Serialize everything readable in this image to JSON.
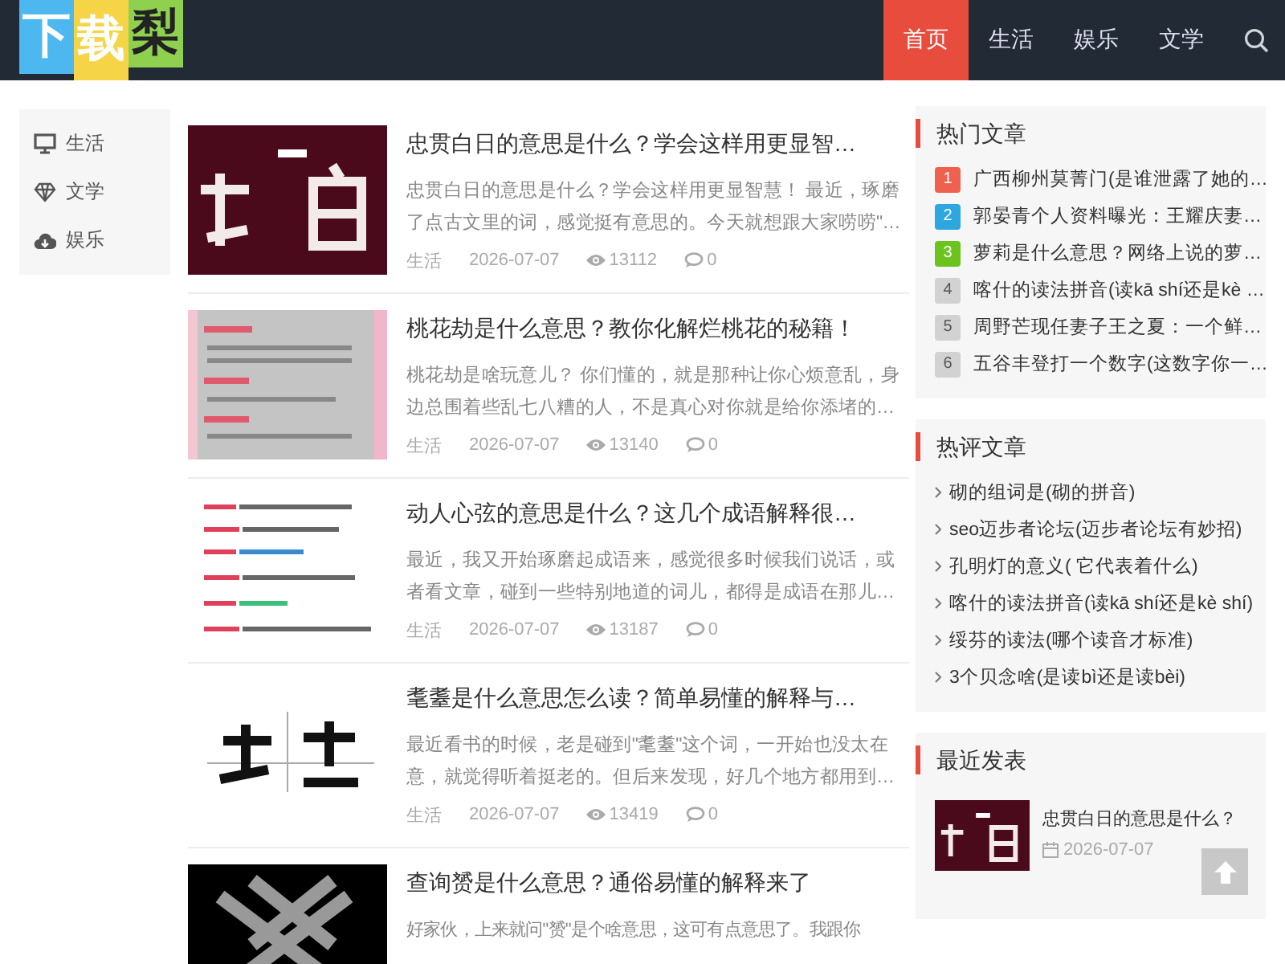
{
  "logo": {
    "tiles": [
      {
        "text": "下",
        "color": "#4cb8ef"
      },
      {
        "text": "载",
        "color": "#f5d547"
      },
      {
        "text": "梨",
        "color": "#8fd14f"
      }
    ]
  },
  "nav": [
    {
      "label": "首页",
      "selected": true
    },
    {
      "label": "生活",
      "selected": false
    },
    {
      "label": "娱乐",
      "selected": false
    },
    {
      "label": "文学",
      "selected": false
    }
  ],
  "sidebar": {
    "items": [
      {
        "label": "生活",
        "kind": "monitor"
      },
      {
        "label": "文学",
        "kind": "diamond"
      },
      {
        "label": "娱乐",
        "kind": "cloud"
      }
    ]
  },
  "articles": [
    {
      "title": "忠贯白日的意思是什么？学会这样用更显智…",
      "excerpt": "忠贯白日的意思是什么？学会这样用更显智慧！ 最近，琢磨了点古文里的词，感觉挺有意思的。今天就想跟大家唠唠\"…",
      "category": "生活",
      "date": "2026-07-07",
      "views": "13112",
      "comments": "0"
    },
    {
      "title": "桃花劫是什么意思？教你化解烂桃花的秘籍！",
      "excerpt": "桃花劫是啥玩意儿？ 你们懂的，就是那种让你心烦意乱，身边总围着些乱七八糟的人，不是真心对你就是给你添堵的…",
      "category": "生活",
      "date": "2026-07-07",
      "views": "13140",
      "comments": "0"
    },
    {
      "title": "动人心弦的意思是什么？这几个成语解释很…",
      "excerpt": "最近，我又开始琢磨起成语来，感觉很多时候我们说话，或者看文章，碰到一些特别地道的词儿，都得是成语在那儿…",
      "category": "生活",
      "date": "2026-07-07",
      "views": "13187",
      "comments": "0"
    },
    {
      "title": "耄耋是什么意思怎么读？简单易懂的解释与…",
      "excerpt": "最近看书的时候，老是碰到\"耄耋\"这个词，一开始也没太在意，就觉得听着挺老的。但后来发现，好几个地方都用到…",
      "category": "生活",
      "date": "2026-07-07",
      "views": "13419",
      "comments": "0"
    },
    {
      "title": "查询赟是什么意思？通俗易懂的解释来了",
      "excerpt": "好家伙，上来就问\"赟\"是个啥意思，这可有点意思了。我跟你"
    }
  ],
  "hot": {
    "title": "热门文章",
    "items": [
      {
        "rank": "1",
        "color": "#f0604f",
        "title": "广西柳州莫菁门(是谁泄露了她的…"
      },
      {
        "rank": "2",
        "color": "#2ea7e0",
        "title": "郭晏青个人资料曝光：王耀庆妻…"
      },
      {
        "rank": "3",
        "color": "#6cc31d",
        "title": "萝莉是什么意思？网络上说的萝…"
      },
      {
        "rank": "4",
        "color": "#d2d2d2",
        "title": "喀什的读法拼音(读kā shí还是kè …"
      },
      {
        "rank": "5",
        "color": "#d2d2d2",
        "title": "周野芒现任妻子王之夏：一个鲜…"
      },
      {
        "rank": "6",
        "color": "#d2d2d2",
        "title": "五谷丰登打一个数字(这数字你一…"
      }
    ]
  },
  "comments": {
    "title": "热评文章",
    "items": [
      "砌的组词是(砌的拼音)",
      "seo迈步者论坛(迈步者论坛有妙招)",
      "孔明灯的意义( 它代表着什么)",
      "喀什的读法拼音(读kā shí还是kè shí)",
      "绥芬的读法(哪个读音才标准)",
      "3个贝念啥(是读bì还是读bèi)"
    ]
  },
  "recent": {
    "title": "最近发表",
    "items": [
      {
        "title": "忠贯白日的意思是什么？",
        "date": "2026-07-07"
      }
    ]
  }
}
